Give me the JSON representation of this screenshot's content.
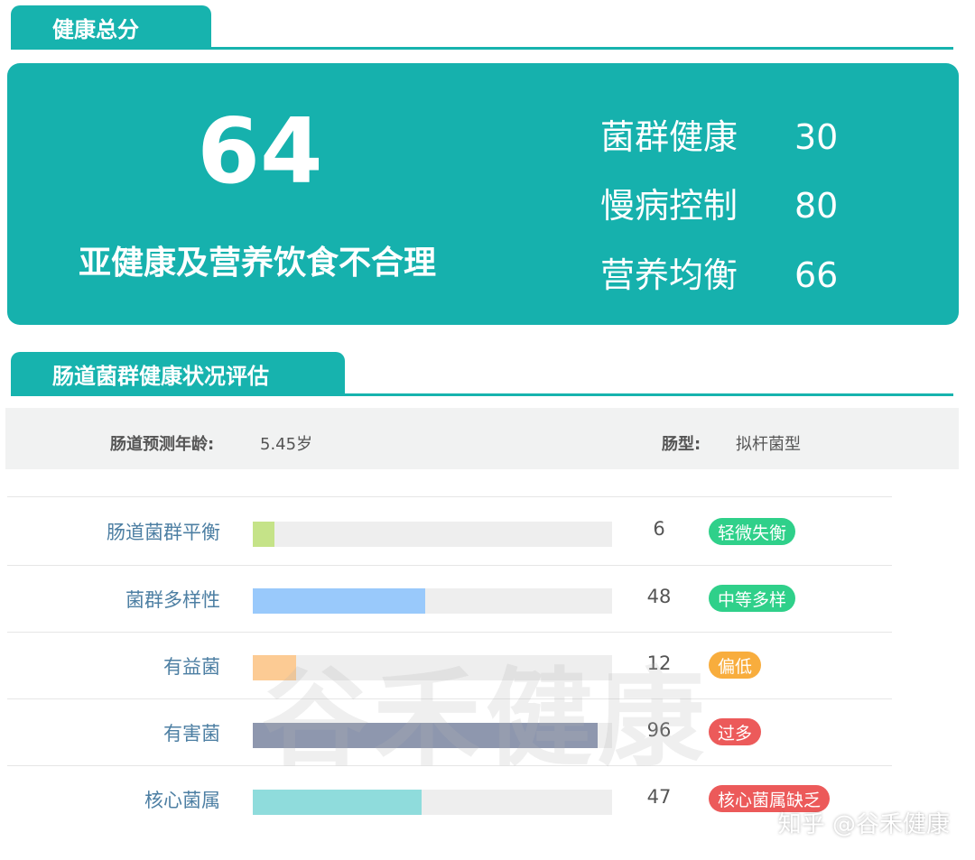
{
  "health_total": {
    "tab_title": "健康总分",
    "score": "64",
    "description": "亚健康及营养饮食不合理",
    "metrics": [
      {
        "name": "菌群健康",
        "value": "30"
      },
      {
        "name": "慢病控制",
        "value": "80"
      },
      {
        "name": "营养均衡",
        "value": "66"
      }
    ]
  },
  "gut_assessment": {
    "tab_title": "肠道菌群健康状况评估",
    "predicted_age_label": "肠道预测年龄:",
    "predicted_age_value": "5.45岁",
    "type_label": "肠型:",
    "type_value": "拟杆菌型",
    "rows": [
      {
        "label": "肠道菌群平衡",
        "value": "6",
        "fraction": 0.06,
        "badge": "轻微失衡",
        "bar_color": "#c5e388",
        "badge_color": "#2fd08a"
      },
      {
        "label": "菌群多样性",
        "value": "48",
        "fraction": 0.48,
        "badge": "中等多样",
        "bar_color": "#99c9fb",
        "badge_color": "#2fd08a"
      },
      {
        "label": "有益菌",
        "value": "12",
        "fraction": 0.12,
        "badge": "偏低",
        "bar_color": "#fccb94",
        "badge_color": "#f8ad3d"
      },
      {
        "label": "有害菌",
        "value": "96",
        "fraction": 0.96,
        "badge": "过多",
        "bar_color": "#8e97ae",
        "badge_color": "#ec5a5a"
      },
      {
        "label": "核心菌属",
        "value": "47",
        "fraction": 0.47,
        "badge": "核心菌属缺乏",
        "bar_color": "#8fdcdc",
        "badge_color": "#ec5a5a"
      }
    ]
  },
  "watermark_text": "谷禾健康",
  "footer_credit": "知乎 @谷禾健康",
  "colors": {
    "teal": "#17b3ae"
  }
}
